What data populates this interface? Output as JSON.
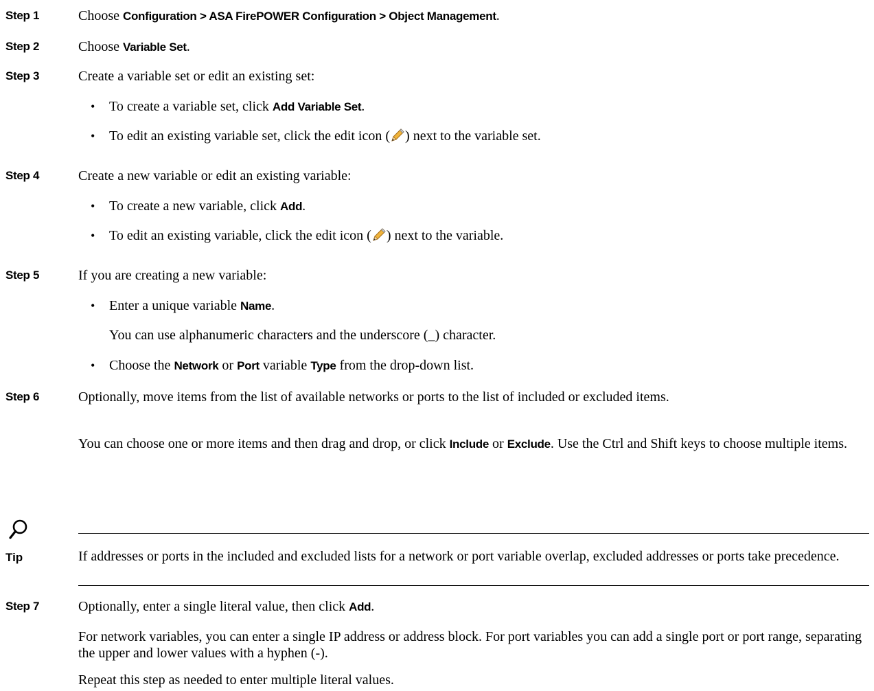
{
  "steps": [
    {
      "label": "Step 1",
      "pre": "Choose ",
      "bold": "Configuration > ASA FirePOWER Configuration > Object Management",
      "post": "."
    },
    {
      "label": "Step 2",
      "pre": "Choose ",
      "bold": "Variable Set",
      "post": "."
    },
    {
      "label": "Step 3",
      "text": "Create a variable set or edit an existing set:"
    },
    {
      "label": "Step 4",
      "text": "Create a new variable or edit an existing variable:"
    },
    {
      "label": "Step 5",
      "text": "If you are creating a new variable:"
    },
    {
      "label": "Step 6",
      "text": "Optionally, move items from the list of available networks or ports to the list of included or excluded items."
    },
    {
      "label": "Step 7",
      "pre": "Optionally, enter a single literal value, then click ",
      "bold": "Add",
      "post": "."
    }
  ],
  "step3_bullets": [
    {
      "pre": "To create a variable set, click ",
      "bold": "Add Variable Set",
      "post": "."
    },
    {
      "pre": "To edit an existing variable set, click the edit icon (",
      "post": ") next to the variable set."
    }
  ],
  "step4_bullets": [
    {
      "pre": "To create a new variable, click ",
      "bold": "Add",
      "post": "."
    },
    {
      "pre": "To edit an existing variable, click the edit icon (",
      "post": ") next to the variable."
    }
  ],
  "step5": {
    "bullet1": {
      "pre": "Enter a unique variable ",
      "bold": "Name",
      "post": "."
    },
    "sub": "You can use alphanumeric characters and the underscore (_) character.",
    "bullet2": {
      "pre": "Choose the ",
      "b1": "Network",
      "mid1": " or ",
      "b2": "Port",
      "mid2": " variable ",
      "b3": "Type",
      "post": " from the drop-down list."
    }
  },
  "step6_para": {
    "pre": "You can choose one or more items and then drag and drop, or click ",
    "b1": "Include",
    "mid": " or ",
    "b2": "Exclude",
    "post": ". Use the Ctrl and Shift keys to choose multiple items."
  },
  "tip": {
    "label": "Tip",
    "text": "If addresses or ports in the included and excluded lists for a network or port variable overlap, excluded addresses or ports take precedence."
  },
  "step7_paras": [
    "For network variables, you can enter a single IP address or address block. For port variables you can add a single port or port range, separating the upper and lower values with a hyphen (-).",
    "Repeat this step as needed to enter multiple literal values."
  ]
}
